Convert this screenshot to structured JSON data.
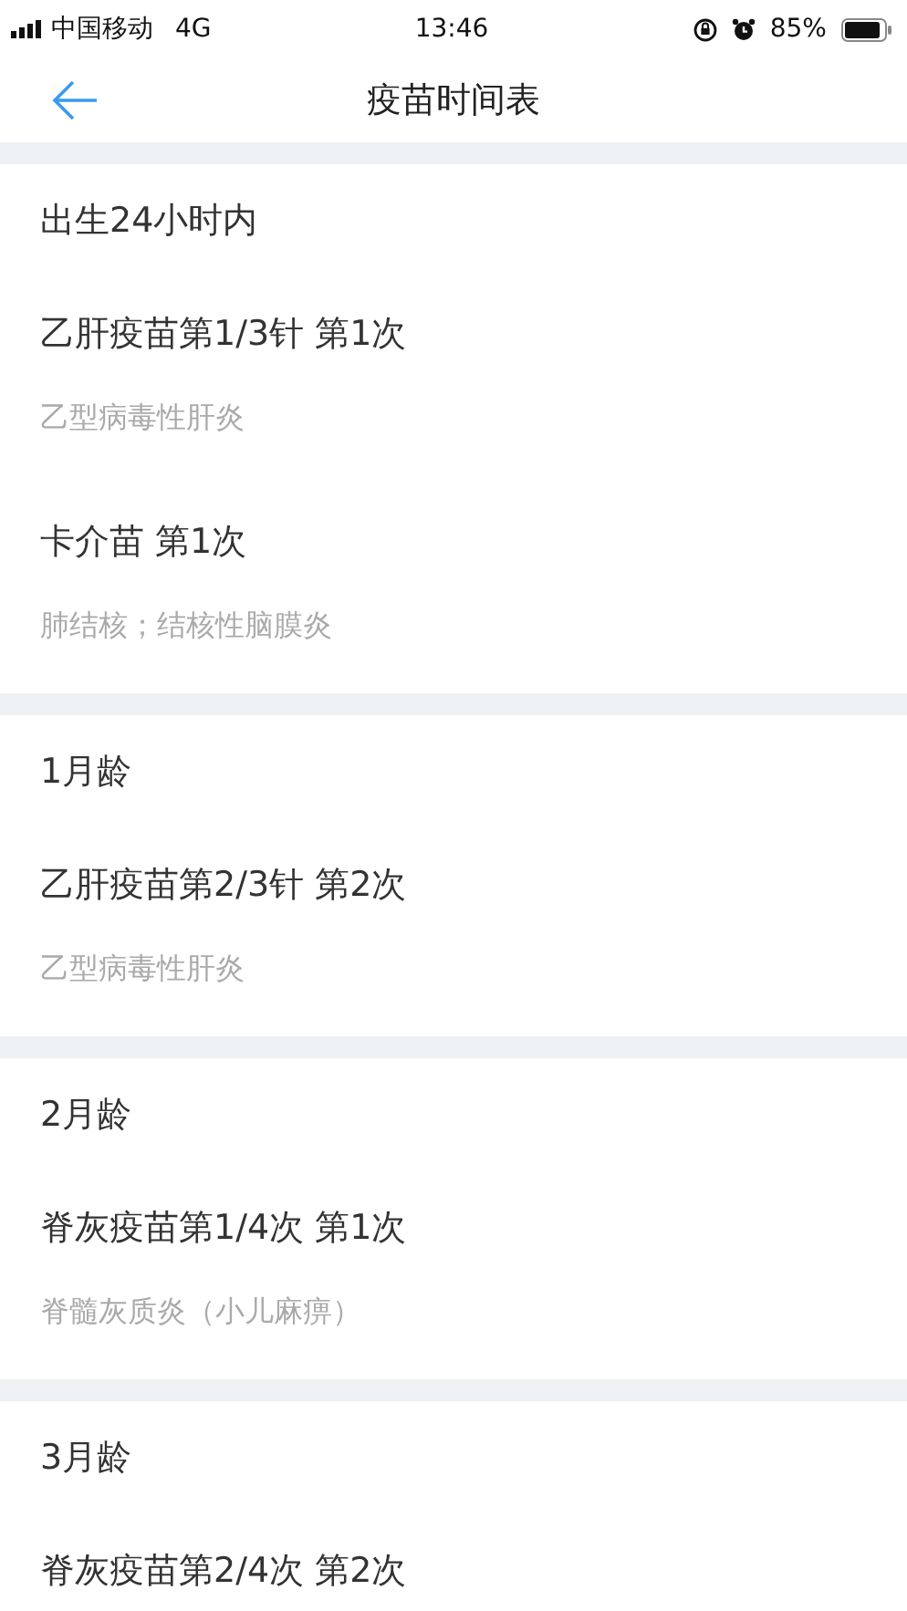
{
  "status_bar": {
    "carrier": "中国移动",
    "network": "4G",
    "time": "13:46",
    "battery": "85%"
  },
  "nav": {
    "title": "疫苗时间表"
  },
  "sections": [
    {
      "age": "出生24小时内",
      "vaccines": [
        {
          "name": "乙肝疫苗第1/3针 第1次",
          "disease": "乙型病毒性肝炎"
        },
        {
          "name": "卡介苗 第1次",
          "disease": "肺结核；结核性脑膜炎"
        }
      ]
    },
    {
      "age": "1月龄",
      "vaccines": [
        {
          "name": "乙肝疫苗第2/3针 第2次",
          "disease": "乙型病毒性肝炎"
        }
      ]
    },
    {
      "age": "2月龄",
      "vaccines": [
        {
          "name": "脊灰疫苗第1/4次 第1次",
          "disease": "脊髓灰质炎（小儿麻痹）"
        }
      ]
    },
    {
      "age": "3月龄",
      "vaccines": [
        {
          "name": "脊灰疫苗第2/4次 第2次"
        }
      ]
    }
  ]
}
